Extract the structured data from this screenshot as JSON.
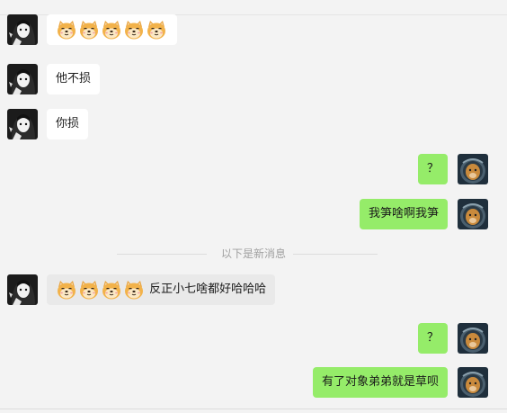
{
  "messages": [
    {
      "side": "left",
      "emoji_count": 5,
      "text": ""
    },
    {
      "side": "left",
      "emoji_count": 0,
      "text": "他不损"
    },
    {
      "side": "left",
      "emoji_count": 0,
      "text": "你损"
    },
    {
      "side": "right",
      "emoji_count": 0,
      "text": "？"
    },
    {
      "side": "right",
      "emoji_count": 0,
      "text": "我笋啥啊我笋"
    },
    {
      "side": "left",
      "emoji_count": 4,
      "text": "反正小七啥都好哈哈哈"
    },
    {
      "side": "right",
      "emoji_count": 0,
      "text": "？"
    },
    {
      "side": "right",
      "emoji_count": 0,
      "text": "有了对象弟弟就是草呗"
    }
  ],
  "divider": {
    "label": "以下是新消息"
  },
  "emoji_name": "doge-emoji",
  "colors": {
    "background": "#f3f3f3",
    "incoming_bubble": "#ffffff",
    "highlight_bubble": "#e9e9e9",
    "outgoing_bubble": "#95ec69",
    "divider_text": "#a0a0a0"
  }
}
